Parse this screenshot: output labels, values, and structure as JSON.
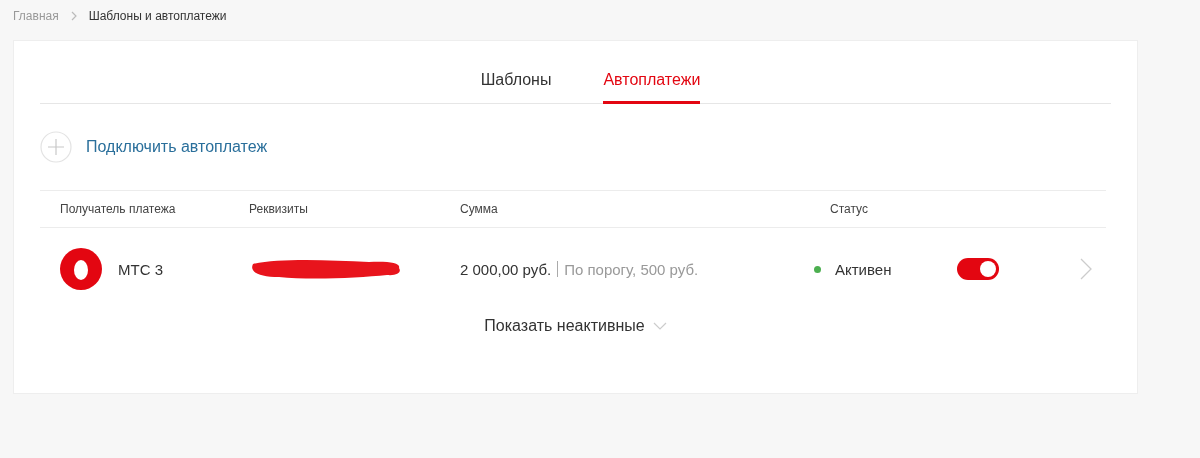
{
  "breadcrumb": [
    {
      "label": "Главная",
      "current": false
    },
    {
      "label": "Шаблоны и автоплатежи",
      "current": true
    }
  ],
  "tabs": [
    {
      "label": "Шаблоны",
      "selected": false
    },
    {
      "label": "Автоплатежи",
      "selected": true
    }
  ],
  "add_action": {
    "label": "Подключить автоплатеж"
  },
  "table": {
    "columns": [
      "Получатель платежа",
      "Реквизиты",
      "Сумма",
      "Статус"
    ],
    "rows": [
      {
        "recipient": "МТС 3",
        "amount": "2 000,00 руб.",
        "condition": "По порогу, 500 руб.",
        "status": {
          "label": "Активен",
          "color": "#4caf50"
        },
        "on": true
      }
    ]
  },
  "show_inactive": {
    "label": "Показать неактивные"
  }
}
